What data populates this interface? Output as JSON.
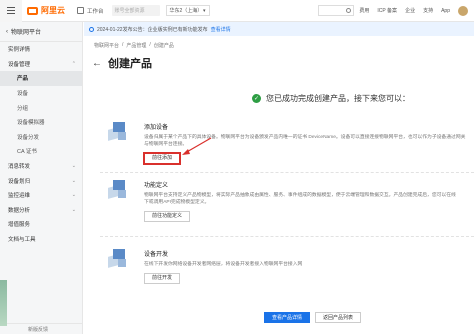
{
  "topbar": {
    "logo_text": "阿里云",
    "workspace": "工作台",
    "search_placeholder": "账号全部资源",
    "region": "华东2（上海）",
    "nav": [
      "费用",
      "ICP 备案",
      "企业",
      "支持",
      "App"
    ]
  },
  "sidebar": {
    "title": "物联网平台",
    "items": [
      {
        "label": "实例详情",
        "sub": false,
        "active": false,
        "chev": ""
      },
      {
        "label": "设备管理",
        "sub": false,
        "active": false,
        "chev": "^"
      },
      {
        "label": "产品",
        "sub": true,
        "active": true,
        "chev": ""
      },
      {
        "label": "设备",
        "sub": true,
        "active": false,
        "chev": ""
      },
      {
        "label": "分组",
        "sub": true,
        "active": false,
        "chev": ""
      },
      {
        "label": "设备模拟器",
        "sub": true,
        "active": false,
        "chev": ""
      },
      {
        "label": "设备分发",
        "sub": true,
        "active": false,
        "chev": ""
      },
      {
        "label": "CA 证书",
        "sub": true,
        "active": false,
        "chev": ""
      },
      {
        "label": "消息转发",
        "sub": false,
        "active": false,
        "chev": "v"
      },
      {
        "label": "设备划归",
        "sub": false,
        "active": false,
        "chev": "v"
      },
      {
        "label": "监控运维",
        "sub": false,
        "active": false,
        "chev": "v"
      },
      {
        "label": "数据分析",
        "sub": false,
        "active": false,
        "chev": "v"
      },
      {
        "label": "增值服务",
        "sub": false,
        "active": false,
        "chev": ""
      },
      {
        "label": "文档与工具",
        "sub": false,
        "active": false,
        "chev": ""
      }
    ],
    "footer": "新版反馈"
  },
  "notice": {
    "text": "2024-01-22发布公告：企业版实例已有新功能发布",
    "link": "查看详情"
  },
  "breadcrumb": [
    "物联网平台",
    "产品管理",
    "创建产品"
  ],
  "page_title": "创建产品",
  "success_text": "您已成功完成创建产品，接下来您可以：",
  "steps": [
    {
      "title": "添加设备",
      "desc_lines": [
        "设备归属于某个产品下的具体设备。物联网平台为设备颁发产品内唯一的证书 DeviceName。设备可以直接连接物联网平台，也可以作为子设备通过网关",
        "与物联网平台连接。"
      ],
      "button": "前往添加"
    },
    {
      "title": "功能定义",
      "desc_lines": [
        "物联网平台支持定义产品物模型，将实际产品抽象成由属性、服务、事件组成的数据模型，便于云端管理和数据交互。产品创建完成后，您可以在线",
        "下或调用API完成物模型定义。"
      ],
      "button": "前往功能定义"
    },
    {
      "title": "设备开发",
      "desc_lines": [
        "在线下开发你网络设备开发者网络层，将设备开发者接入物联网平台接入网"
      ],
      "button": "前往开发"
    }
  ],
  "footer_buttons": {
    "primary": "查看产品详情",
    "secondary": "返回产品列表"
  }
}
